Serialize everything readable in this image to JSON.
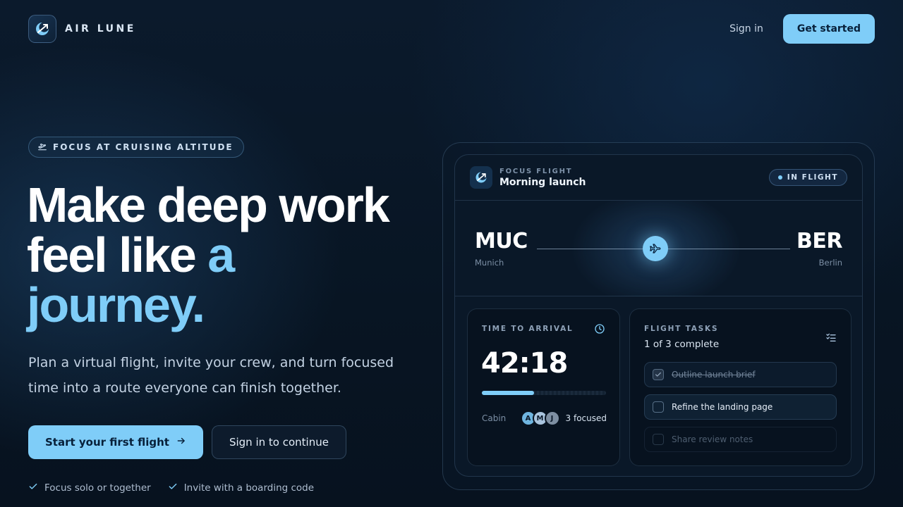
{
  "brand": {
    "name": "AIR LUNE",
    "logo_icon": "crescent-plane-icon"
  },
  "nav": {
    "signin_label": "Sign in",
    "get_started_label": "Get started"
  },
  "hero": {
    "badge": "FOCUS AT CRUISING ALTITUDE",
    "headline_main": "Make deep work feel like ",
    "headline_accent": "a journey.",
    "subcopy": "Plan a virtual flight, invite your crew, and turn focused time into a route everyone can finish together.",
    "cta_primary": "Start your first flight",
    "cta_secondary": "Sign in to continue",
    "features": [
      "Focus solo or together",
      "Invite with a boarding code"
    ]
  },
  "flight": {
    "eyebrow": "FOCUS FLIGHT",
    "title": "Morning launch",
    "status": "IN FLIGHT",
    "origin": {
      "code": "MUC",
      "city": "Munich"
    },
    "destination": {
      "code": "BER",
      "city": "Berlin"
    },
    "time": {
      "label": "TIME TO ARRIVAL",
      "value": "42:18",
      "progress": 0.42
    },
    "cabin": {
      "label": "Cabin",
      "crew": [
        "A",
        "M",
        "J"
      ],
      "count_text": "3 focused"
    },
    "tasks": {
      "label": "FLIGHT TASKS",
      "summary": "1 of 3 complete",
      "items": [
        {
          "text": "Outline launch brief",
          "done": true
        },
        {
          "text": "Refine the landing page",
          "done": false
        },
        {
          "text": "Share review notes",
          "done": false
        }
      ]
    }
  },
  "colors": {
    "accent": "#7fcdf8",
    "background": "#081523",
    "card": "#0a1828"
  }
}
